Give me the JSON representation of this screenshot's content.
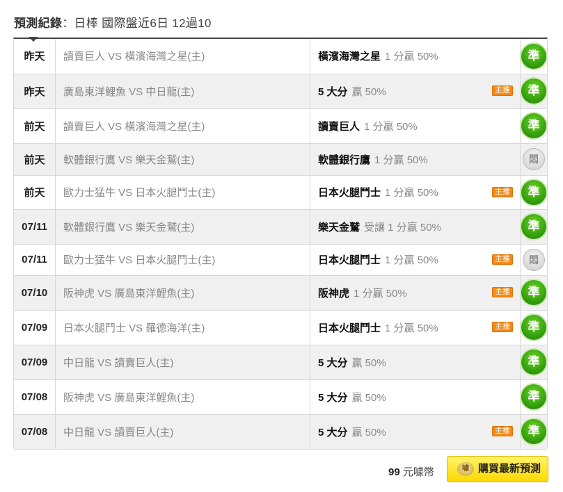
{
  "header": {
    "label": "預測紀錄",
    "separator": "：",
    "detail": "日棒 國際盤近6日 12過10"
  },
  "rows": [
    {
      "date": "昨天",
      "match": "讀賣巨人 VS 橫濱海灣之星(主)",
      "pick": "橫濱海灣之星",
      "cond": "1 分贏 50%",
      "badge": "",
      "result": "準",
      "status": "win"
    },
    {
      "date": "昨天",
      "match": "廣島東洋鯉魚 VS 中日龍(主)",
      "pick": "5 大分",
      "cond": "贏 50%",
      "badge": "主推",
      "result": "準",
      "status": "win"
    },
    {
      "date": "前天",
      "match": "讀賣巨人 VS 橫濱海灣之星(主)",
      "pick": "讀賣巨人",
      "cond": "1 分贏 50%",
      "badge": "",
      "result": "準",
      "status": "win"
    },
    {
      "date": "前天",
      "match": "軟體銀行鷹 VS 樂天金鷲(主)",
      "pick": "軟體銀行鷹",
      "cond": "1 分贏 50%",
      "badge": "",
      "result": "悶",
      "status": "push"
    },
    {
      "date": "前天",
      "match": "歐力士猛牛 VS 日本火腿鬥士(主)",
      "pick": "日本火腿鬥士",
      "cond": "1 分贏 50%",
      "badge": "主推",
      "result": "準",
      "status": "win"
    },
    {
      "date": "07/11",
      "match": "軟體銀行鷹 VS 樂天金鷲(主)",
      "pick": "樂天金鷲",
      "cond": "受讓 1 分贏 50%",
      "badge": "",
      "result": "準",
      "status": "win"
    },
    {
      "date": "07/11",
      "match": "歐力士猛牛 VS 日本火腿鬥士(主)",
      "pick": "日本火腿鬥士",
      "cond": "1 分贏 50%",
      "badge": "主推",
      "result": "悶",
      "status": "push"
    },
    {
      "date": "07/10",
      "match": "阪神虎 VS 廣島東洋鯉魚(主)",
      "pick": "阪神虎",
      "cond": "1 分贏 50%",
      "badge": "主推",
      "result": "準",
      "status": "win"
    },
    {
      "date": "07/09",
      "match": "日本火腿鬥士 VS 羅德海洋(主)",
      "pick": "日本火腿鬥士",
      "cond": "1 分贏 50%",
      "badge": "主推",
      "result": "準",
      "status": "win"
    },
    {
      "date": "07/09",
      "match": "中日龍 VS 讀賣巨人(主)",
      "pick": "5 大分",
      "cond": "贏 50%",
      "badge": "",
      "result": "準",
      "status": "win"
    },
    {
      "date": "07/08",
      "match": "阪神虎 VS 廣島東洋鯉魚(主)",
      "pick": "5 大分",
      "cond": "贏 50%",
      "badge": "",
      "result": "準",
      "status": "win"
    },
    {
      "date": "07/08",
      "match": "中日龍 VS 讀賣巨人(主)",
      "pick": "5 大分",
      "cond": "贏 50%",
      "badge": "主推",
      "result": "準",
      "status": "win"
    }
  ],
  "footer": {
    "price": "99",
    "unit": "元噱幣",
    "coin_label": "噱",
    "buy_label": "購買最新預測"
  },
  "colors": {
    "row_alt": "#f0f0f0",
    "win": "#3aa60f",
    "badge": "#f28a1a",
    "button": "#ffe21a"
  }
}
